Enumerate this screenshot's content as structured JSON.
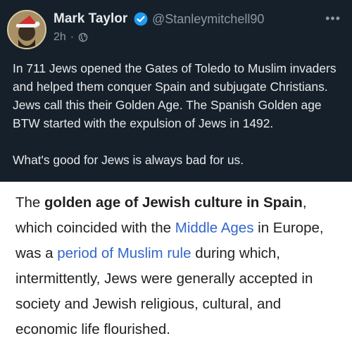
{
  "tweet": {
    "author_name": "Mark Taylor",
    "handle": "@Stanleymitchell90",
    "time": "2h",
    "separator": "·",
    "more_label": "•••",
    "paragraph1": "In 711 Jews opened the Gates of Toledo to Muslim invaders and helped them conquer Spain and subjugate Christians. Jews call this their Golden Age. The Spanish Golden age BTW started with the expulsion of Jews in 1492.",
    "paragraph2": "What's good for Jews is always bad for us.",
    "icons": {
      "avatar": "avatar",
      "verified": "verified-badge-icon",
      "globe": "globe-icon",
      "more": "more-options-icon"
    },
    "colors": {
      "background": "#15202b",
      "verified": "#1d9bf0",
      "secondary_text": "#8b98a5"
    }
  },
  "wiki": {
    "seg1": "The ",
    "bold": "golden age of Jewish culture in Spain",
    "seg2": ", which coincided with the ",
    "link1": "Middle Ages",
    "seg3": " in Europe, was a ",
    "link2": "period of Muslim rule",
    "seg4": " during which, intermittently, Jews were generally accepted in society and Jewish religious, cultural, and economic life flourished.",
    "colors": {
      "link": "#3366cc",
      "text": "#202122"
    }
  }
}
